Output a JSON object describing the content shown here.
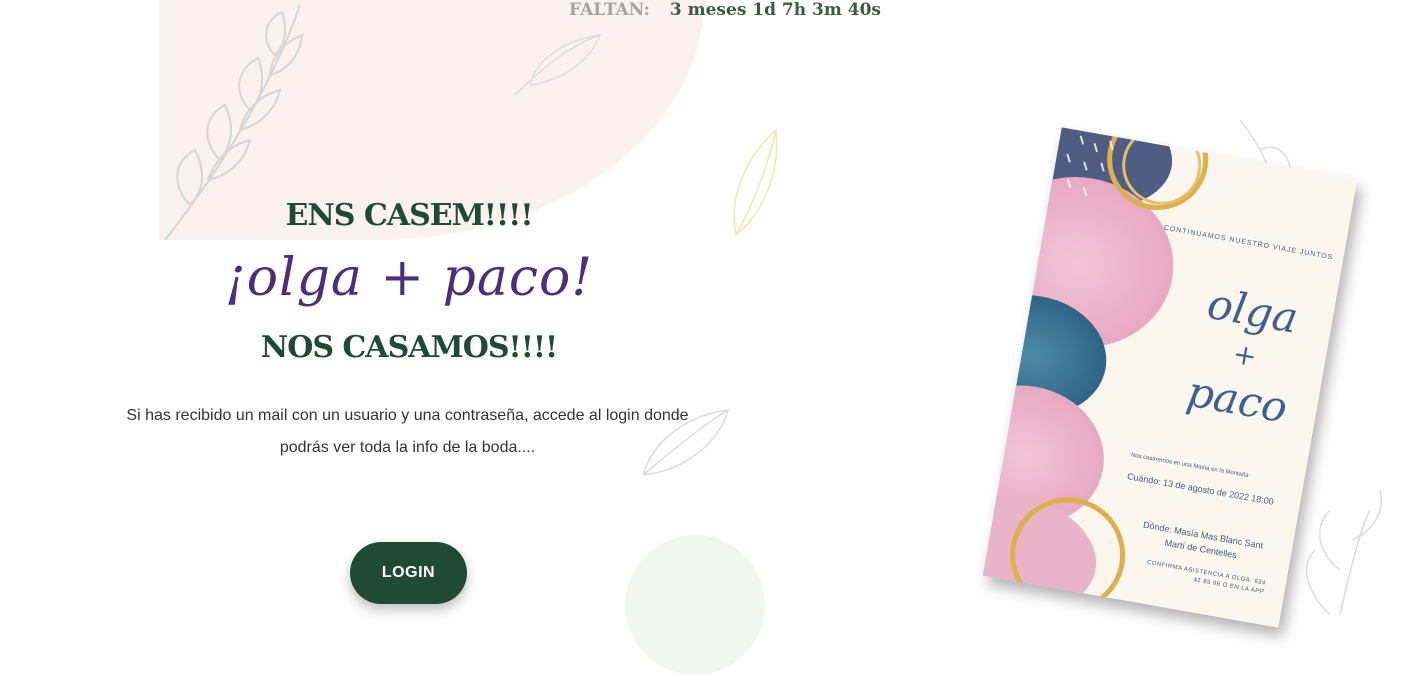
{
  "countdown": {
    "label": "FALTAN:",
    "value": "3 meses 1d 7h 3m 40s"
  },
  "hero": {
    "title_top": "ENS CASEM!!!!",
    "names": "¡olga + paco!",
    "title_bottom": "NOS CASAMOS!!!!",
    "body": "Si has recibido un mail con un usuario y una contraseña, accede al login donde podrás ver toda la info de la boda...."
  },
  "login": {
    "label": "LOGIN"
  },
  "invitation": {
    "subtitle": "CONTINUAMOS NUESTRO VIAJE JUNTOS",
    "name_1": "olga",
    "plus": "+",
    "name_2": "paco",
    "small": "Nos casaremos en una Masía en la Montaña",
    "when": "Cuándo: 13 de agosto de 2022 18:00",
    "where": "Dónde: Masía Mas Blanc Sant Martí de Centelles",
    "confirm": "CONFIRMA ASISTENCIA A OLGA: 634 41 85 98 O EN LA APP"
  },
  "colors": {
    "accent": "#1f4a38",
    "names": "#4b2e7c",
    "invite_text": "#3d5b87"
  }
}
